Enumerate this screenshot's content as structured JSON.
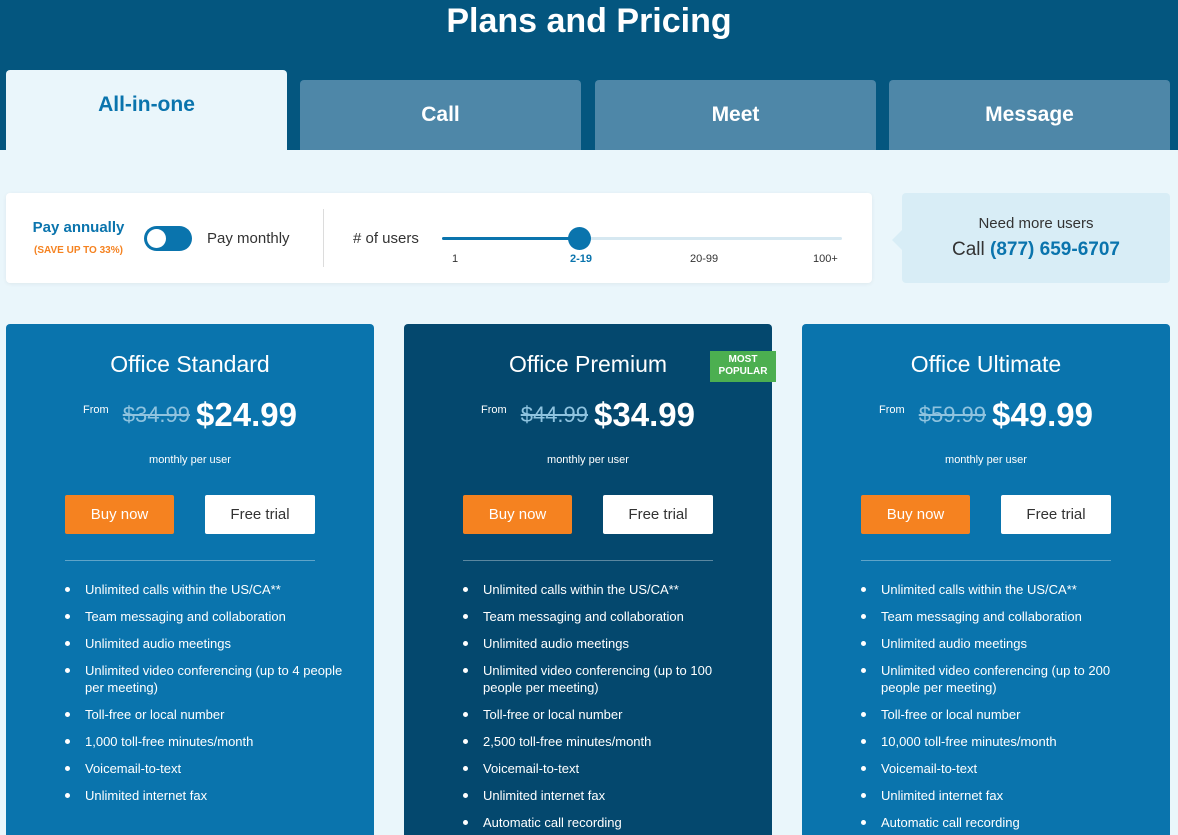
{
  "header": {
    "title": "Plans and Pricing"
  },
  "tabs": [
    {
      "label": "All-in-one",
      "active": true
    },
    {
      "label": "Call",
      "active": false
    },
    {
      "label": "Meet",
      "active": false
    },
    {
      "label": "Message",
      "active": false
    }
  ],
  "controls": {
    "pay_annually": "Pay annually",
    "save_note": "(SAVE UP TO 33%)",
    "pay_monthly": "Pay monthly",
    "users_label": "# of users",
    "slider_ticks": [
      "1",
      "2-19",
      "20-99",
      "100+"
    ],
    "slider_selected": "2-19"
  },
  "need_more": {
    "title": "Need more users",
    "call_prefix": "Call",
    "phone": "(877) 659-6707"
  },
  "plans": [
    {
      "title": "Office Standard",
      "from": "From",
      "old_price": "$34.99",
      "price": "$24.99",
      "period": "monthly per user",
      "buy": "Buy now",
      "trial": "Free trial",
      "features": [
        "Unlimited calls within the US/CA**",
        "Team messaging and collaboration",
        "Unlimited audio meetings",
        "Unlimited video conferencing (up to 4 people per meeting)",
        "Toll-free or local number",
        "1,000 toll-free minutes/month",
        "Voicemail-to-text",
        "Unlimited internet fax"
      ]
    },
    {
      "title": "Office Premium",
      "badge": "MOST POPULAR",
      "from": "From",
      "old_price": "$44.99",
      "price": "$34.99",
      "period": "monthly per user",
      "buy": "Buy now",
      "trial": "Free trial",
      "features": [
        "Unlimited calls within the US/CA**",
        "Team messaging and collaboration",
        "Unlimited audio meetings",
        "Unlimited video conferencing (up to 100 people per meeting)",
        "Toll-free or local number",
        "2,500 toll-free minutes/month",
        "Voicemail-to-text",
        "Unlimited internet fax",
        "Automatic call recording"
      ]
    },
    {
      "title": "Office Ultimate",
      "from": "From",
      "old_price": "$59.99",
      "price": "$49.99",
      "period": "monthly per user",
      "buy": "Buy now",
      "trial": "Free trial",
      "features": [
        "Unlimited calls within the US/CA**",
        "Team messaging and collaboration",
        "Unlimited audio meetings",
        "Unlimited video conferencing (up to 200 people per meeting)",
        "Toll-free or local number",
        "10,000 toll-free minutes/month",
        "Voicemail-to-text",
        "Unlimited internet fax",
        "Automatic call recording"
      ]
    }
  ],
  "colors": {
    "header": "#04567f",
    "brand_blue": "#0a74ad",
    "premium_card": "#04486e",
    "buy_button": "#f58220",
    "badge": "#4caf50"
  }
}
